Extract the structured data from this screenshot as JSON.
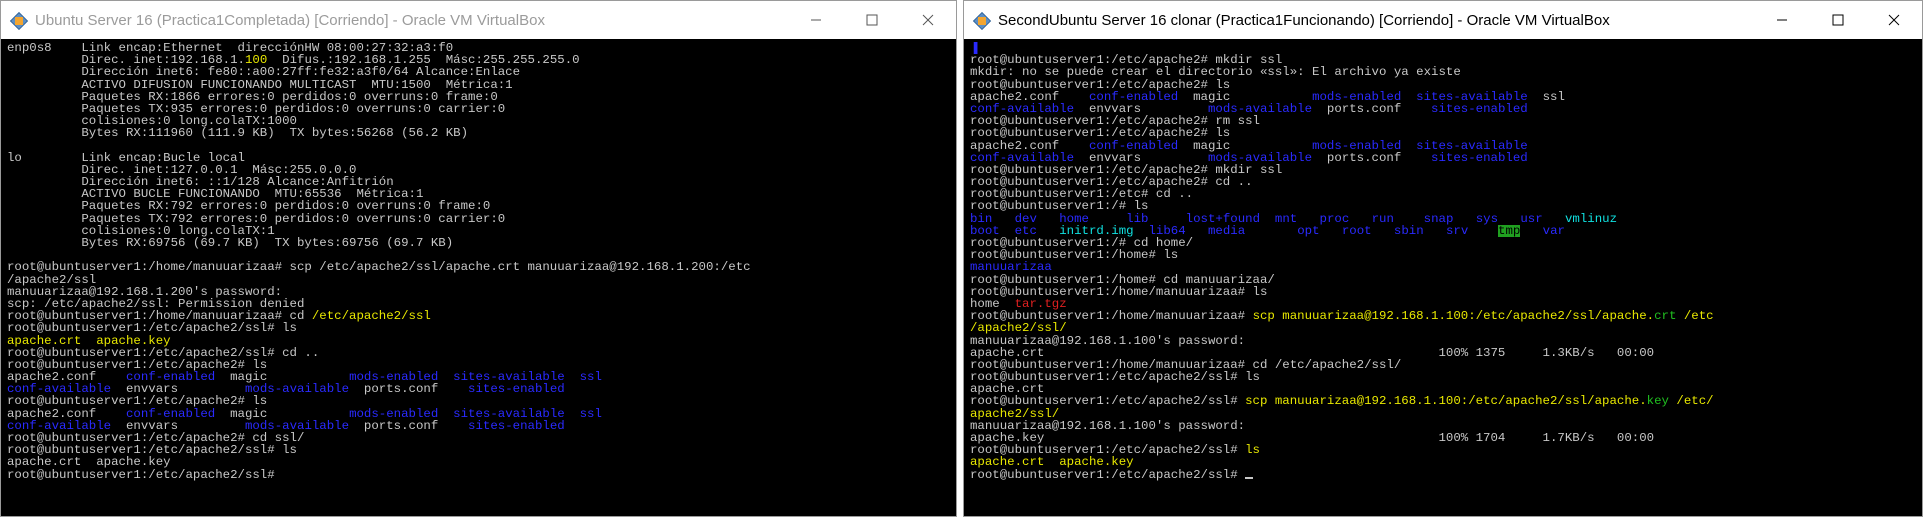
{
  "left_window": {
    "title": "Ubuntu Server 16 (Practica1Completada) [Corriendo] - Oracle VM VirtualBox",
    "lines": [
      [
        {
          "t": "enp0s8    Link encap:Ethernet  direcciónHW 08:00:27:32:a3:f0"
        }
      ],
      [
        {
          "t": "          Direc. inet:192.168.1."
        },
        {
          "t": "100",
          "c": "yellow"
        },
        {
          "t": "  Difus.:192.168.1.255  Másc:255.255.255.0"
        }
      ],
      [
        {
          "t": "          Dirección inet6: fe80::a00:27ff:fe32:a3f0/64 Alcance:Enlace"
        }
      ],
      [
        {
          "t": "          ACTIVO DIFUSIÓN FUNCIONANDO MULTICAST  MTU:1500  Métrica:1"
        }
      ],
      [
        {
          "t": "          Paquetes RX:1866 errores:0 perdidos:0 overruns:0 frame:0"
        }
      ],
      [
        {
          "t": "          Paquetes TX:935 errores:0 perdidos:0 overruns:0 carrier:0"
        }
      ],
      [
        {
          "t": "          colisiones:0 long.colaTX:1000"
        }
      ],
      [
        {
          "t": "          Bytes RX:111960 (111.9 KB)  TX bytes:56268 (56.2 KB)"
        }
      ],
      [
        {
          "t": ""
        }
      ],
      [
        {
          "t": "lo        Link encap:Bucle local"
        }
      ],
      [
        {
          "t": "          Direc. inet:127.0.0.1  Másc:255.0.0.0"
        }
      ],
      [
        {
          "t": "          Dirección inet6: ::1/128 Alcance:Anfitrión"
        }
      ],
      [
        {
          "t": "          ACTIVO BUCLE FUNCIONANDO  MTU:65536  Métrica:1"
        }
      ],
      [
        {
          "t": "          Paquetes RX:792 errores:0 perdidos:0 overruns:0 frame:0"
        }
      ],
      [
        {
          "t": "          Paquetes TX:792 errores:0 perdidos:0 overruns:0 carrier:0"
        }
      ],
      [
        {
          "t": "          colisiones:0 long.colaTX:1"
        }
      ],
      [
        {
          "t": "          Bytes RX:69756 (69.7 KB)  TX bytes:69756 (69.7 KB)"
        }
      ],
      [
        {
          "t": ""
        }
      ],
      [
        {
          "t": "root@ubuntuserver1:/home/manuuarizaa# scp /etc/apache2/ssl/apache.crt manuuarizaa@192.168.1.200:/etc"
        }
      ],
      [
        {
          "t": "/apache2/ssl"
        }
      ],
      [
        {
          "t": "manuuarizaa@192.168.1.200's password:"
        }
      ],
      [
        {
          "t": "scp: /etc/apache2/ssl: Permission denied"
        }
      ],
      [
        {
          "t": "root@ubuntuserver1:/home/manuuarizaa# cd "
        },
        {
          "t": "/etc/apache2/ssl",
          "c": "yellow"
        }
      ],
      [
        {
          "t": "root@ubuntuserver1:/etc/apache2/ssl# ls"
        }
      ],
      [
        {
          "t": "apache.crt  apache.key",
          "c": "yellow"
        }
      ],
      [
        {
          "t": "root@ubuntuserver1:/etc/apache2/ssl# cd .."
        }
      ],
      [
        {
          "t": "root@ubuntuserver1:/etc/apache2# ls"
        }
      ],
      [
        {
          "t": "apache2.conf    "
        },
        {
          "t": "conf-enabled",
          "c": "blue"
        },
        {
          "t": "  magic           "
        },
        {
          "t": "mods-enabled",
          "c": "blue"
        },
        {
          "t": "  "
        },
        {
          "t": "sites-available",
          "c": "blue"
        },
        {
          "t": "  "
        },
        {
          "t": "ssl",
          "c": "blue"
        }
      ],
      [
        {
          "t": "conf-available",
          "c": "blue"
        },
        {
          "t": "  envvars         "
        },
        {
          "t": "mods-available",
          "c": "blue"
        },
        {
          "t": "  ports.conf    "
        },
        {
          "t": "sites-enabled",
          "c": "blue"
        }
      ],
      [
        {
          "t": "root@ubuntuserver1:/etc/apache2# ls"
        }
      ],
      [
        {
          "t": "apache2.conf    "
        },
        {
          "t": "conf-enabled",
          "c": "blue"
        },
        {
          "t": "  magic           "
        },
        {
          "t": "mods-enabled",
          "c": "blue"
        },
        {
          "t": "  "
        },
        {
          "t": "sites-available",
          "c": "blue"
        },
        {
          "t": "  "
        },
        {
          "t": "ssl",
          "c": "blue"
        }
      ],
      [
        {
          "t": "conf-available",
          "c": "blue"
        },
        {
          "t": "  envvars         "
        },
        {
          "t": "mods-available",
          "c": "blue"
        },
        {
          "t": "  ports.conf    "
        },
        {
          "t": "sites-enabled",
          "c": "blue"
        }
      ],
      [
        {
          "t": "root@ubuntuserver1:/etc/apache2# cd ssl/"
        }
      ],
      [
        {
          "t": "root@ubuntuserver1:/etc/apache2/ssl# ls"
        }
      ],
      [
        {
          "t": "apache.crt  apache.key"
        }
      ],
      [
        {
          "t": "root@ubuntuserver1:/etc/apache2/ssl# "
        }
      ]
    ]
  },
  "right_window": {
    "title": "SecondUbuntu Server 16 clonar (Practica1Funcionando) [Corriendo] - Oracle VM VirtualBox",
    "lines": [
      [
        {
          "t": "▐",
          "c": "blue"
        }
      ],
      [
        {
          "t": "root@ubuntuserver1:/etc/apache2# mkdir ssl"
        }
      ],
      [
        {
          "t": "mkdir: no se puede crear el directorio «ssl»: El archivo ya existe"
        }
      ],
      [
        {
          "t": "root@ubuntuserver1:/etc/apache2# ls"
        }
      ],
      [
        {
          "t": "apache2.conf    "
        },
        {
          "t": "conf-enabled",
          "c": "blue"
        },
        {
          "t": "  magic           "
        },
        {
          "t": "mods-enabled",
          "c": "blue"
        },
        {
          "t": "  "
        },
        {
          "t": "sites-available",
          "c": "blue"
        },
        {
          "t": "  ssl"
        }
      ],
      [
        {
          "t": "conf-available",
          "c": "blue"
        },
        {
          "t": "  envvars         "
        },
        {
          "t": "mods-available",
          "c": "blue"
        },
        {
          "t": "  ports.conf    "
        },
        {
          "t": "sites-enabled",
          "c": "blue"
        }
      ],
      [
        {
          "t": "root@ubuntuserver1:/etc/apache2# rm ssl"
        }
      ],
      [
        {
          "t": "root@ubuntuserver1:/etc/apache2# ls"
        }
      ],
      [
        {
          "t": "apache2.conf    "
        },
        {
          "t": "conf-enabled",
          "c": "blue"
        },
        {
          "t": "  magic           "
        },
        {
          "t": "mods-enabled",
          "c": "blue"
        },
        {
          "t": "  "
        },
        {
          "t": "sites-available",
          "c": "blue"
        }
      ],
      [
        {
          "t": "conf-available",
          "c": "blue"
        },
        {
          "t": "  envvars         "
        },
        {
          "t": "mods-available",
          "c": "blue"
        },
        {
          "t": "  ports.conf    "
        },
        {
          "t": "sites-enabled",
          "c": "blue"
        }
      ],
      [
        {
          "t": "root@ubuntuserver1:/etc/apache2# mkdir ssl"
        }
      ],
      [
        {
          "t": "root@ubuntuserver1:/etc/apache2# cd .."
        }
      ],
      [
        {
          "t": "root@ubuntuserver1:/etc# cd .."
        }
      ],
      [
        {
          "t": "root@ubuntuserver1:/# ls"
        }
      ],
      [
        {
          "t": "bin   ",
          "c": "blue"
        },
        {
          "t": "dev   ",
          "c": "blue"
        },
        {
          "t": "home     ",
          "c": "blue"
        },
        {
          "t": "lib     ",
          "c": "blue"
        },
        {
          "t": "lost+found  ",
          "c": "blue"
        },
        {
          "t": "mnt   ",
          "c": "blue"
        },
        {
          "t": "proc   ",
          "c": "blue"
        },
        {
          "t": "run    ",
          "c": "blue"
        },
        {
          "t": "snap   ",
          "c": "blue"
        },
        {
          "t": "sys   ",
          "c": "blue"
        },
        {
          "t": "usr   ",
          "c": "blue"
        },
        {
          "t": "vmlinuz",
          "c": "cyan"
        }
      ],
      [
        {
          "t": "boot  ",
          "c": "blue"
        },
        {
          "t": "etc   ",
          "c": "blue"
        },
        {
          "t": "initrd.img  ",
          "c": "cyan"
        },
        {
          "t": "lib64   ",
          "c": "blue"
        },
        {
          "t": "media       ",
          "c": "blue"
        },
        {
          "t": "opt   ",
          "c": "blue"
        },
        {
          "t": "root   ",
          "c": "blue"
        },
        {
          "t": "sbin   ",
          "c": "blue"
        },
        {
          "t": "srv    ",
          "c": "blue"
        },
        {
          "t": "tmp",
          "c": "hlgreen"
        },
        {
          "t": "   "
        },
        {
          "t": "var",
          "c": "blue"
        }
      ],
      [
        {
          "t": "root@ubuntuserver1:/# cd home/"
        }
      ],
      [
        {
          "t": "root@ubuntuserver1:/home# ls"
        }
      ],
      [
        {
          "t": "manuuarizaa",
          "c": "blue"
        }
      ],
      [
        {
          "t": "root@ubuntuserver1:/home# cd manuuarizaa/"
        }
      ],
      [
        {
          "t": "root@ubuntuserver1:/home/manuuarizaa# ls"
        }
      ],
      [
        {
          "t": "home  "
        },
        {
          "t": "tar.tgz",
          "c": "red"
        }
      ],
      [
        {
          "t": "root@ubuntuserver1:/home/manuuarizaa# "
        },
        {
          "t": "scp manuuarizaa@192.168.1.100:/etc/apache2/ssl/apache.",
          "c": "yellow"
        },
        {
          "t": "crt",
          "c": "green"
        },
        {
          "t": " /etc",
          "c": "yellow"
        }
      ],
      [
        {
          "t": "/apache2/ssl/",
          "c": "yellow"
        }
      ],
      [
        {
          "t": "manuuarizaa@192.168.1.100's password:"
        }
      ],
      [
        {
          "t": "apache.crt                                                     100% 1375     1.3KB/s   00:00"
        }
      ],
      [
        {
          "t": "root@ubuntuserver1:/home/manuuarizaa# cd /etc/apache2/ssl/"
        }
      ],
      [
        {
          "t": "root@ubuntuserver1:/etc/apache2/ssl# ls"
        }
      ],
      [
        {
          "t": "apache.crt"
        }
      ],
      [
        {
          "t": "root@ubuntuserver1:/etc/apache2/ssl# "
        },
        {
          "t": "scp manuuarizaa@192.168.1.100:/etc/apache2/ssl/apache.",
          "c": "yellow"
        },
        {
          "t": "key",
          "c": "green"
        },
        {
          "t": " /etc/",
          "c": "yellow"
        }
      ],
      [
        {
          "t": "apache2/ssl/",
          "c": "yellow"
        }
      ],
      [
        {
          "t": "manuuarizaa@192.168.1.100's password:"
        }
      ],
      [
        {
          "t": "apache.key                                                     100% 1704     1.7KB/s   00:00"
        }
      ],
      [
        {
          "t": "root@ubuntuserver1:/etc/apache2/ssl# "
        },
        {
          "t": "ls",
          "c": "yellow"
        }
      ],
      [
        {
          "t": "apache.crt  apache.key",
          "c": "yellow"
        }
      ],
      [
        {
          "t": "root@ubuntuserver1:/etc/apache2/ssl# "
        }
      ]
    ]
  }
}
